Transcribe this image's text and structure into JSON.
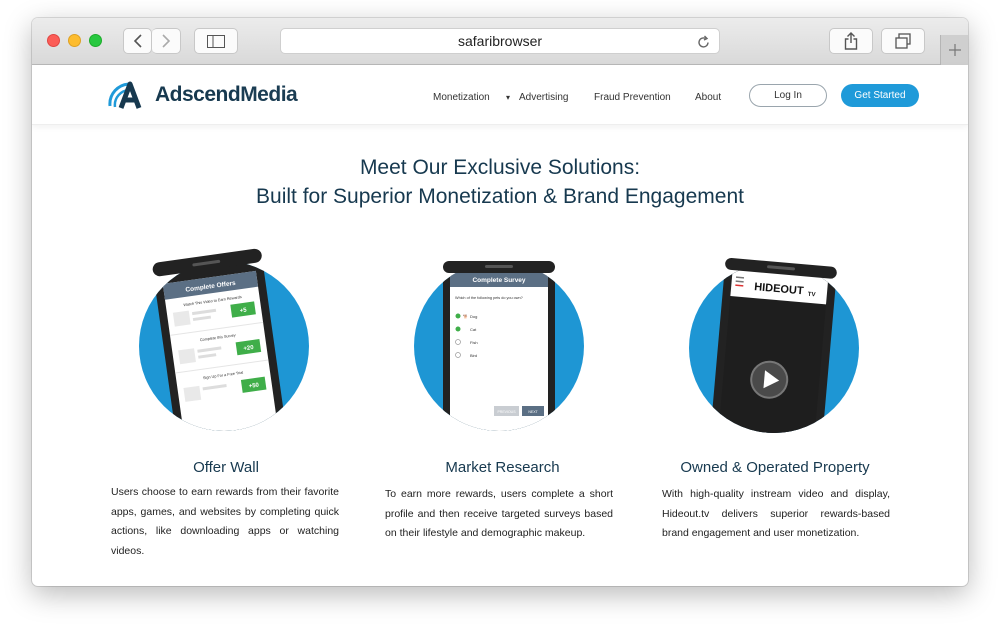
{
  "browser": {
    "address": "safaribrowser"
  },
  "nav": {
    "logo_text_a": "Adscend",
    "logo_text_b": "Media",
    "menu": [
      "Monetization",
      "Advertising",
      "Fraud Prevention",
      "About"
    ],
    "login_label": "Log In",
    "get_started_label": "Get Started"
  },
  "hero": {
    "line1": "Meet Our Exclusive Solutions:",
    "line2": "Built for Superior Monetization & Brand Engagement"
  },
  "features": [
    {
      "title": "Offer Wall",
      "description": "Users choose to earn rewards from their favorite apps, games, and websites by completing quick actions, like downloading apps or watching videos.",
      "phone": {
        "header": "Complete Offers",
        "rows": [
          {
            "label": "Watch This Video to Earn Rewards",
            "reward": "+5"
          },
          {
            "label": "Complete this Survey",
            "reward": "+20"
          },
          {
            "label": "Sign Up For a Free Trial",
            "reward": "+50"
          }
        ]
      }
    },
    {
      "title": "Market Research",
      "description": "To earn more rewards, users complete a short profile and then receive targeted surveys based on their lifestyle and demographic makeup.",
      "phone": {
        "header": "Complete Survey",
        "question": "Which of the following pets do you own?",
        "options": [
          "Dog",
          "Cat",
          "Fish",
          "Bird"
        ],
        "prev_label": "PREVIOUS",
        "next_label": "NEXT"
      }
    },
    {
      "title": "Owned & Operated Property",
      "description": "With high-quality instream video and display, Hideout.tv delivers superior rewards-based brand engagement and user monetization.",
      "phone": {
        "brand": "HIDEOUT",
        "brand_suffix": "TV"
      }
    }
  ],
  "colors": {
    "brand_dark": "#17394f",
    "accent_blue": "#1f9ad9",
    "circle_blue": "#1e96d4",
    "reward_green": "#3fae49"
  }
}
